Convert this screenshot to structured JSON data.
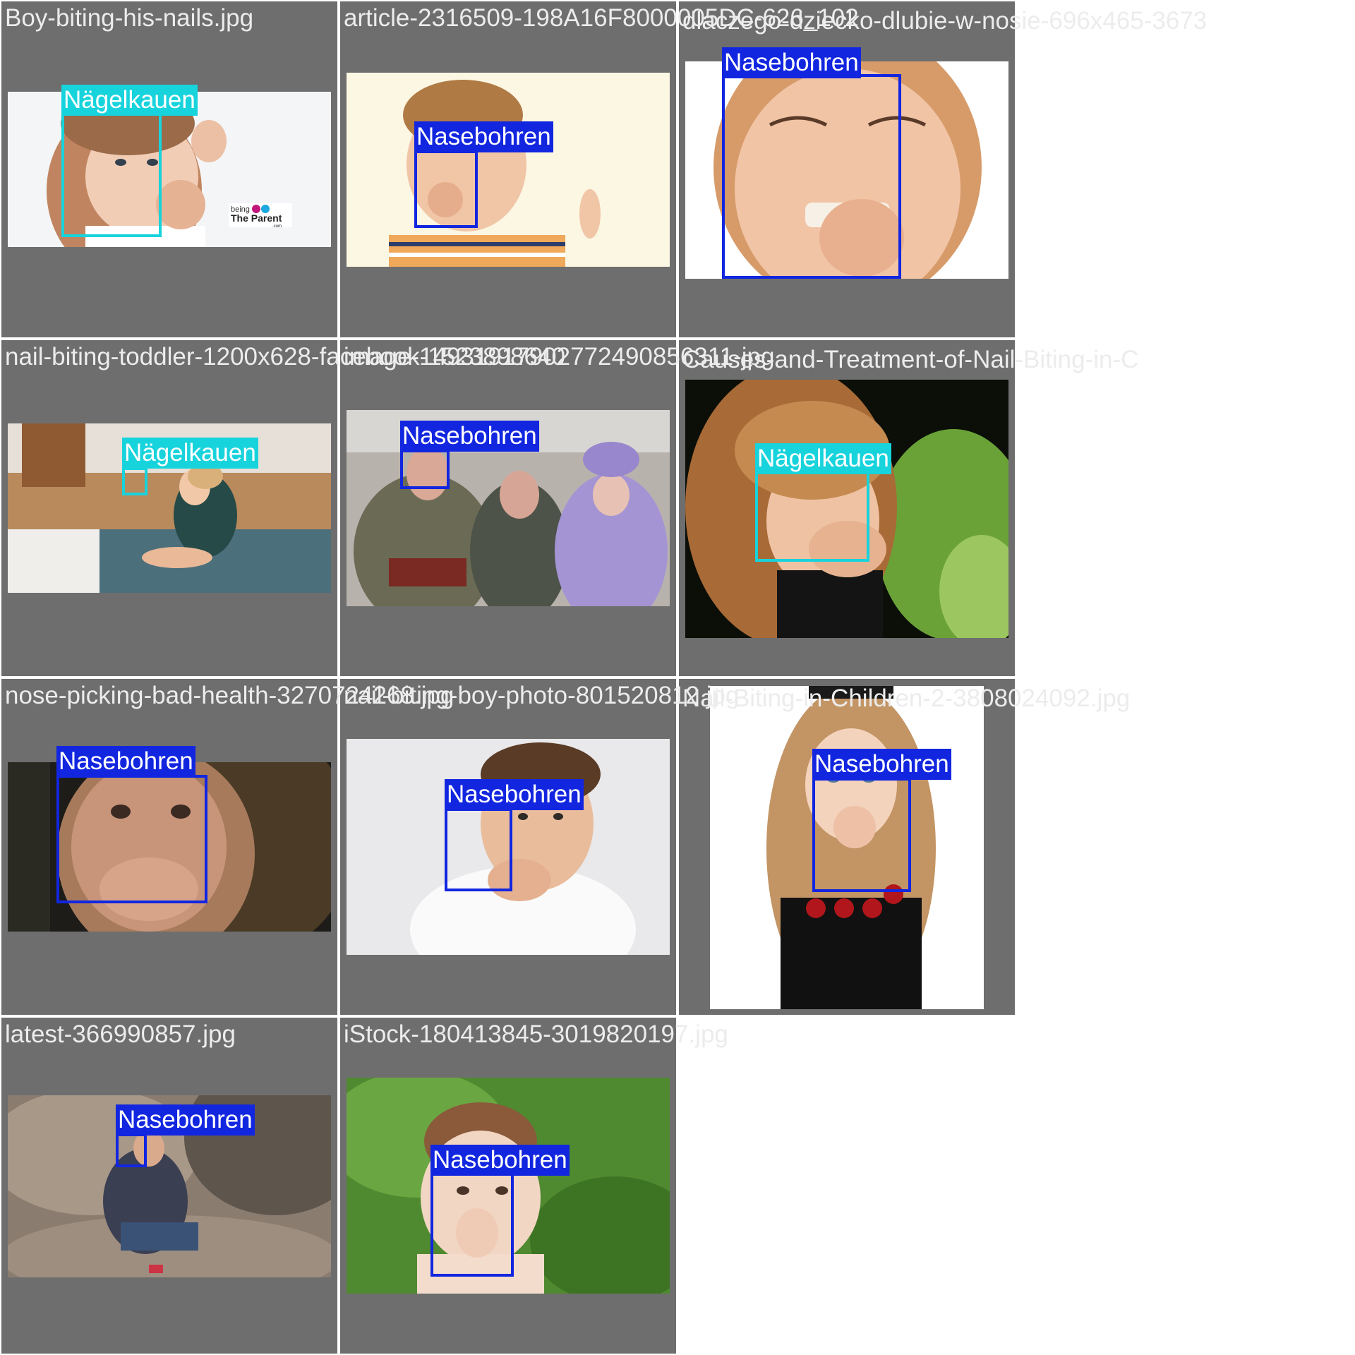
{
  "colors": {
    "tile_bg": "#6e6e6e",
    "filename_text": "#ececec",
    "class_colors": {
      "Nasebohren": "#1226e0",
      "Nägelkauen": "#17d3dc"
    }
  },
  "tiles": [
    {
      "filename": "Boy-biting-his-nails.jpg",
      "detections": [
        {
          "label": "Nägelkauen"
        }
      ],
      "watermark": {
        "line1": "being",
        "line2": "The Parent",
        "line3": ".com"
      }
    },
    {
      "filename": "article-2316509-198A16F8000005DC-626_102",
      "detections": [
        {
          "label": "Nasebohren"
        }
      ]
    },
    {
      "filename": "dlaczego-dziecko-dlubie-w-nosie-696x465-3673",
      "detections": [
        {
          "label": "Nasebohren"
        }
      ]
    },
    {
      "filename": "nail-biting-toddler-1200x628-facebook-1523898640",
      "detections": [
        {
          "label": "Nägelkauen"
        }
      ]
    },
    {
      "filename": "image-14931917902772490856311-jpg",
      "detections": [
        {
          "label": "Nasebohren"
        }
      ]
    },
    {
      "filename": "Causes-and-Treatment-of-Nail-Biting-in-C",
      "detections": [
        {
          "label": "Nägelkauen"
        }
      ]
    },
    {
      "filename": "nose-picking-bad-health-3270724268.jpg",
      "detections": [
        {
          "label": "Nasebohren"
        }
      ]
    },
    {
      "filename": "nail-biting-boy-photo-801520812.jpg",
      "detections": [
        {
          "label": "Nasebohren"
        }
      ]
    },
    {
      "filename": "Nail-Biting-in-Children-2-3808024092.jpg",
      "detections": [
        {
          "label": "Nasebohren"
        }
      ]
    },
    {
      "filename": "latest-366990857.jpg",
      "detections": [
        {
          "label": "Nasebohren"
        }
      ]
    },
    {
      "filename": "iStock-180413845-3019820197.jpg",
      "detections": [
        {
          "label": "Nasebohren"
        }
      ]
    }
  ]
}
